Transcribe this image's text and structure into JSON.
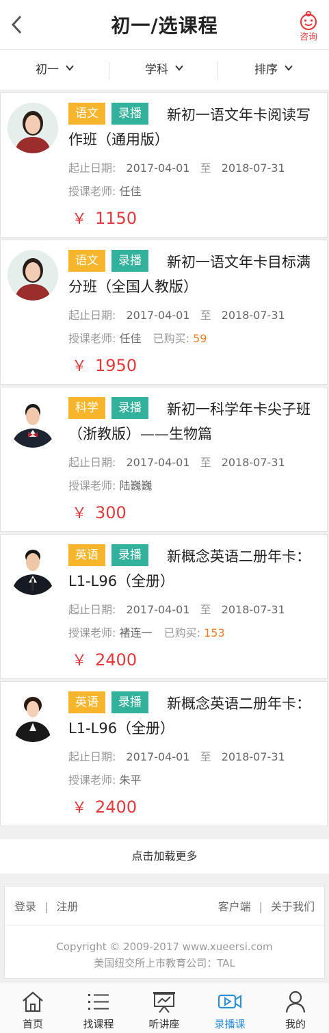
{
  "header": {
    "title": "初一/选课程",
    "consult_label": "咨询",
    "back_icon": "chevron-left-icon",
    "consult_icon": "monkey-face-icon"
  },
  "filters": [
    {
      "label": "初一"
    },
    {
      "label": "学科"
    },
    {
      "label": "排序"
    }
  ],
  "labels": {
    "date": "起止日期:",
    "to": "至",
    "teacher": "授课老师:",
    "bought": "已购买:",
    "yen": "￥"
  },
  "courses": [
    {
      "subject": "语文",
      "type": "录播",
      "title": "新初一语文年卡阅读写作班（通用版）",
      "start": "2017-04-01",
      "end": "2018-07-31",
      "teacher": "任佳",
      "bought": "",
      "price": "1150"
    },
    {
      "subject": "语文",
      "type": "录播",
      "title": "新初一语文年卡目标满分班（全国人教版）",
      "start": "2017-04-01",
      "end": "2018-07-31",
      "teacher": "任佳",
      "bought": "59",
      "price": "1950"
    },
    {
      "subject": "科学",
      "type": "录播",
      "title": "新初一科学年卡尖子班（浙教版）——生物篇",
      "start": "2017-04-01",
      "end": "2018-07-31",
      "teacher": "陆巍巍",
      "bought": "",
      "price": "300"
    },
    {
      "subject": "英语",
      "type": "录播",
      "title": "新概念英语二册年卡：L1-L96（全册）",
      "start": "2017-04-01",
      "end": "2018-07-31",
      "teacher": "褚连一",
      "bought": "153",
      "price": "2400"
    },
    {
      "subject": "英语",
      "type": "录播",
      "title": "新概念英语二册年卡：L1-L96（全册）",
      "start": "2017-04-01",
      "end": "2018-07-31",
      "teacher": "朱平",
      "bought": "",
      "price": "2400"
    }
  ],
  "load_more": "点击加载更多",
  "footer": {
    "login": "登录",
    "register": "注册",
    "client": "客户端",
    "about": "关于我们",
    "copyright": "Copyright © 2009-2017 www.xueersi.com",
    "listed": "美国纽交所上市教育公司：TAL"
  },
  "tabs": [
    {
      "label": "首页",
      "icon": "home-icon"
    },
    {
      "label": "找课程",
      "icon": "list-icon"
    },
    {
      "label": "听讲座",
      "icon": "presentation-icon"
    },
    {
      "label": "录播课",
      "icon": "video-icon"
    },
    {
      "label": "我的",
      "icon": "person-icon"
    }
  ],
  "colors": {
    "subject_tag": "#f7b52c",
    "type_tag": "#32b29c",
    "price": "#e4393c",
    "bought_count": "#f07c22",
    "active_tab": "#2d8fd5"
  }
}
